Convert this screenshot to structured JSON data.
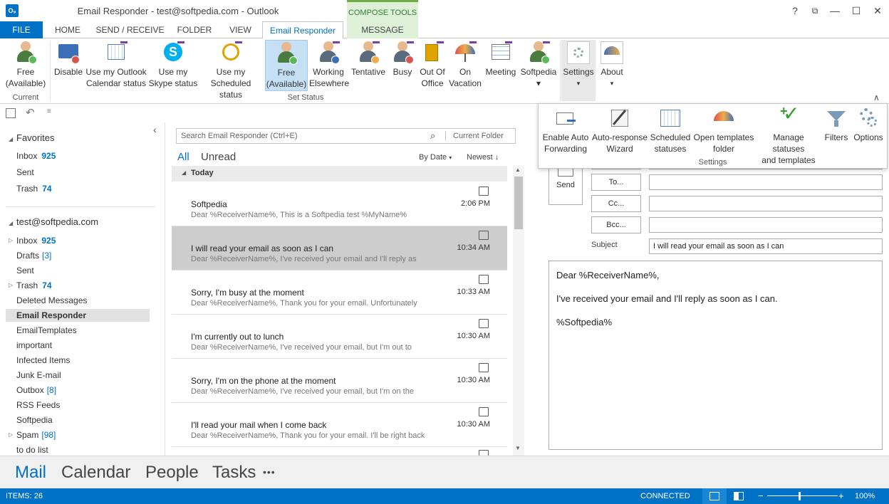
{
  "window": {
    "title": "Email Responder - test@softpedia.com - Outlook",
    "app_logo": "O₉",
    "compose_tools": "COMPOSE TOOLS",
    "help": "?",
    "restore": "⧉",
    "minimize": "—",
    "maximize": "☐",
    "close": "✕"
  },
  "tabs": [
    "FILE",
    "HOME",
    "SEND / RECEIVE",
    "FOLDER",
    "VIEW",
    "Email Responder",
    "MESSAGE"
  ],
  "ribbon": {
    "current_group": "Current",
    "current_button": [
      "Free",
      "(Available)"
    ],
    "set_status_group": "Set Status",
    "status_buttons": [
      {
        "l1": "Disable",
        "l2": ""
      },
      {
        "l1": "Use my Outlook",
        "l2": "Calendar status"
      },
      {
        "l1": "Use my",
        "l2": "Skype status"
      },
      {
        "l1": "Use my",
        "l2": "Scheduled status"
      },
      {
        "l1": "Free",
        "l2": "(Available)"
      },
      {
        "l1": "Working",
        "l2": "Elsewhere"
      },
      {
        "l1": "Tentative",
        "l2": ""
      },
      {
        "l1": "Busy",
        "l2": ""
      },
      {
        "l1": "Out Of",
        "l2": "Office"
      },
      {
        "l1": "On",
        "l2": "Vacation"
      },
      {
        "l1": "Meeting",
        "l2": ""
      },
      {
        "l1": "Softpedia",
        "l2": "▾"
      }
    ],
    "settings_label": "Settings",
    "about_label": "About",
    "caret": "▾",
    "collapse": "∧"
  },
  "settings_popup": {
    "group_label": "Settings",
    "items": [
      {
        "l1": "Enable Auto",
        "l2": "Forwarding"
      },
      {
        "l1": "Auto-response",
        "l2": "Wizard"
      },
      {
        "l1": "Scheduled",
        "l2": "statuses"
      },
      {
        "l1": "Open templates",
        "l2": "folder"
      },
      {
        "l1": "Manage statuses",
        "l2": "and templates"
      },
      {
        "l1": "Filters",
        "l2": ""
      },
      {
        "l1": "Options",
        "l2": ""
      }
    ]
  },
  "qat": {
    "undo": "↶",
    "more": "≡"
  },
  "nav": {
    "collapse": "‹",
    "favorites_header": "Favorites",
    "favorites": [
      {
        "label": "Inbox",
        "count": "925"
      },
      {
        "label": "Sent",
        "count": ""
      },
      {
        "label": "Trash",
        "count": "74"
      }
    ],
    "account_header": "test@softpedia.com",
    "folders": [
      {
        "label": "Inbox",
        "count": "925",
        "bracket": "",
        "tri": "▷"
      },
      {
        "label": "Drafts",
        "count": "",
        "bracket": "[3]",
        "tri": ""
      },
      {
        "label": "Sent",
        "count": "",
        "bracket": "",
        "tri": ""
      },
      {
        "label": "Trash",
        "count": "74",
        "bracket": "",
        "tri": "▷"
      },
      {
        "label": "Deleted Messages",
        "count": "",
        "bracket": "",
        "tri": ""
      },
      {
        "label": "Email Responder",
        "count": "",
        "bracket": "",
        "tri": ""
      },
      {
        "label": "EmailTemplates",
        "count": "",
        "bracket": "",
        "tri": ""
      },
      {
        "label": "important",
        "count": "",
        "bracket": "",
        "tri": ""
      },
      {
        "label": "Infected Items",
        "count": "",
        "bracket": "",
        "tri": ""
      },
      {
        "label": "Junk E-mail",
        "count": "",
        "bracket": "",
        "tri": ""
      },
      {
        "label": "Outbox",
        "count": "",
        "bracket": "[8]",
        "tri": ""
      },
      {
        "label": "RSS Feeds",
        "count": "",
        "bracket": "",
        "tri": ""
      },
      {
        "label": "Softpedia",
        "count": "",
        "bracket": "",
        "tri": ""
      },
      {
        "label": "Spam",
        "count": "",
        "bracket": "[98]",
        "tri": "▷"
      },
      {
        "label": "to do list",
        "count": "",
        "bracket": "",
        "tri": ""
      }
    ]
  },
  "list": {
    "search_placeholder": "Search Email Responder (Ctrl+E)",
    "search_icon": "⌕",
    "scope": "Current Folder",
    "filter_all": "All",
    "filter_unread": "Unread",
    "sort_by": "By Date",
    "sort_order": "Newest",
    "sort_arrow": "↓",
    "group_header": "Today",
    "group_tri": "◢",
    "messages": [
      {
        "subject": "Softpedia",
        "preview": "Dear %ReceiverName%,  This is a Softpedia test  %MyName%",
        "time": "2:06 PM"
      },
      {
        "subject": "I will read your email as soon as I can",
        "preview": "Dear %ReceiverName%,  I've received your email and I'll reply as",
        "time": "10:34 AM"
      },
      {
        "subject": "Sorry, I'm busy at the moment",
        "preview": "Dear %ReceiverName%,  Thank you for your email. Unfortunately",
        "time": "10:33 AM"
      },
      {
        "subject": "I'm currently out to lunch",
        "preview": "Dear %ReceiverName%,  I've received your email, but I'm out to",
        "time": "10:30 AM"
      },
      {
        "subject": "Sorry, I'm on the phone at the moment",
        "preview": "Dear %ReceiverName%,  I've received your email, but I'm on the",
        "time": "10:30 AM"
      },
      {
        "subject": "I'll read your mail when I come back",
        "preview": "Dear %ReceiverName%,  Thank you for your email. I'll be right back",
        "time": "10:30 AM"
      }
    ]
  },
  "compose": {
    "send": "Send",
    "to": "To...",
    "cc": "Cc...",
    "bcc": "Bcc...",
    "subject_label": "Subject",
    "subject_value": "I will read your email as soon as I can",
    "body": [
      "Dear %ReceiverName%,",
      "I've received your email and I'll reply as soon as I can.",
      "%Softpedia%"
    ]
  },
  "bottom_nav": [
    "Mail",
    "Calendar",
    "People",
    "Tasks",
    "•••"
  ],
  "status": {
    "items": "ITEMS: 26",
    "connection": "CONNECTED",
    "zoom": "100%",
    "minus": "−",
    "plus": "+"
  },
  "colors": {
    "accent": "#0072c6",
    "compose_tools": "#dff0d8"
  }
}
